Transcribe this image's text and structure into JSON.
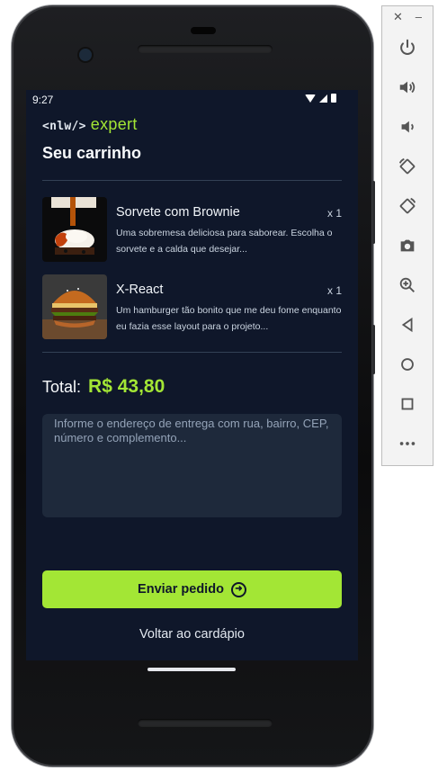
{
  "status_bar": {
    "time": "9:27"
  },
  "logo": {
    "nlw": "<nlw/>",
    "expert": "expert"
  },
  "cart": {
    "title": "Seu carrinho"
  },
  "items": [
    {
      "title": "Sorvete com Brownie",
      "quantity": "x 1",
      "description": "Uma sobremesa deliciosa para saborear. Escolha o sorvete e a calda que desejar..."
    },
    {
      "title": "X-React",
      "quantity": "x 1",
      "description": "Um hamburger tão bonito que me deu fome enquanto eu fazia esse layout para o projeto..."
    }
  ],
  "total": {
    "label": "Total:",
    "value": "R$ 43,80"
  },
  "address": {
    "placeholder": "Informe o endereço de entrega com rua, bairro, CEP, número e complemento..."
  },
  "actions": {
    "send_label": "Enviar pedido",
    "back_label": "Voltar ao cardápio"
  },
  "emulator_toolbar": {
    "buttons": [
      "power-icon",
      "volume-up-icon",
      "volume-down-icon",
      "rotate-left-icon",
      "rotate-right-icon",
      "camera-icon",
      "zoom-icon",
      "back-icon",
      "home-icon",
      "overview-icon",
      "more-icon"
    ]
  },
  "colors": {
    "accent": "#a3e635",
    "background": "#0f172a",
    "input_bg": "#1e293b"
  }
}
